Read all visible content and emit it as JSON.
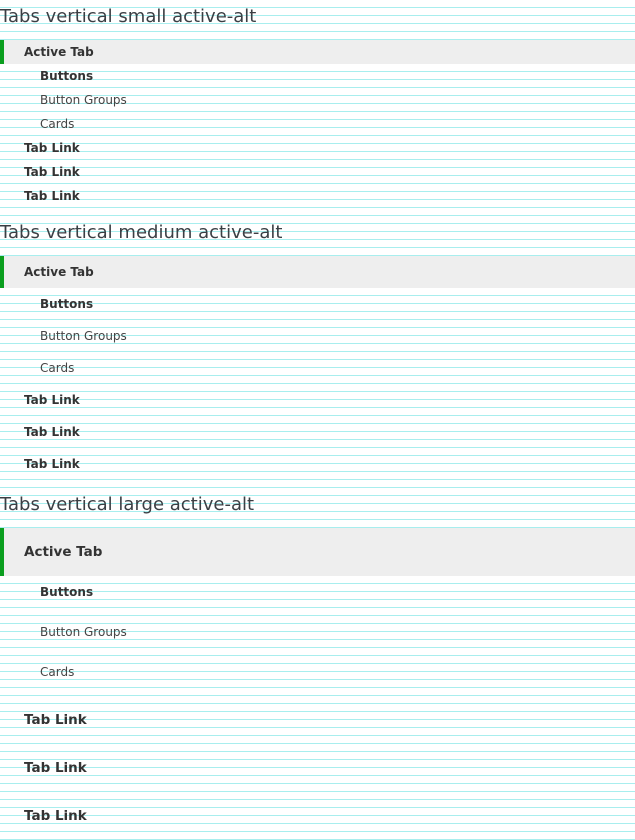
{
  "sections": [
    {
      "title": "Tabs vertical small active-alt",
      "active": "Active Tab",
      "subitems": [
        "Buttons",
        "Button Groups",
        "Cards"
      ],
      "links": [
        "Tab Link",
        "Tab Link",
        "Tab Link"
      ]
    },
    {
      "title": "Tabs vertical medium active-alt",
      "active": "Active Tab",
      "subitems": [
        "Buttons",
        "Button Groups",
        "Cards"
      ],
      "links": [
        "Tab Link",
        "Tab Link",
        "Tab Link"
      ]
    },
    {
      "title": "Tabs vertical large active-alt",
      "active": "Active Tab",
      "subitems": [
        "Buttons",
        "Button Groups",
        "Cards"
      ],
      "links": [
        "Tab Link",
        "Tab Link",
        "Tab Link"
      ]
    }
  ],
  "colors": {
    "accent": "#0a9e1e",
    "active_bg": "#eeeeee",
    "grid_line": "#a8eeee"
  }
}
